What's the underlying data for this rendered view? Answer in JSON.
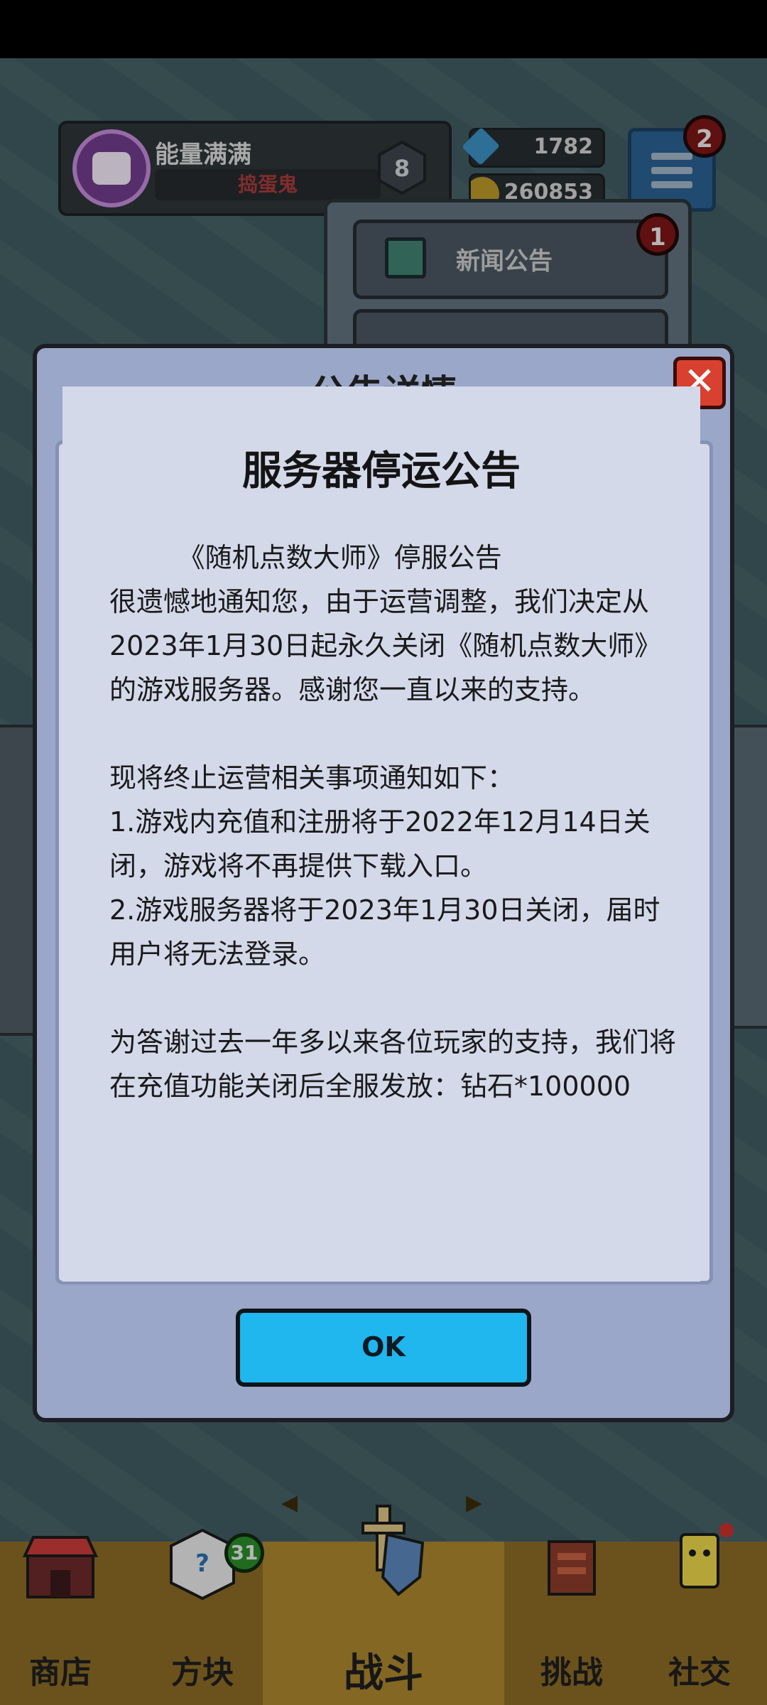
{
  "hud": {
    "player_name": "能量满满",
    "player_tag": "捣蛋鬼",
    "rank_level": "8",
    "gems": "1782",
    "coins": "260853",
    "menu_badge": "2"
  },
  "dropdown": {
    "news_label": "新闻公告",
    "news_badge": "1"
  },
  "modal": {
    "title_peek": "公告详情",
    "announcement_title": "服务器停运公告",
    "body": "        《随机点数大师》停服公告\n很遗憾地通知您，由于运营调整，我们决定从2023年1月30日起永久关闭《随机点数大师》的游戏服务器。感谢您一直以来的支持。\n\n现将终止运营相关事项通知如下：\n1.游戏内充值和注册将于2022年12月14日关闭，游戏将不再提供下载入口。\n2.游戏服务器将于2023年1月30日关闭，届时用户将无法登录。\n\n为答谢过去一年多以来各位玩家的支持，我们将在充值功能关闭后全服发放：钻石*100000",
    "ok_label": "OK"
  },
  "nav": {
    "shop": "商店",
    "blocks": "方块",
    "blocks_badge": "31",
    "battle": "战斗",
    "challenge": "挑战",
    "social": "社交"
  },
  "colors": {
    "ok_button": "#20b6ee",
    "close_button": "#d8412f",
    "modal_frame": "#9aa7c8",
    "content_bg": "#d4d9ea"
  },
  "icons": {
    "close": "close-icon",
    "menu": "hamburger-icon",
    "gem": "gem-icon",
    "coin": "coin-icon",
    "news": "tv-icon"
  }
}
